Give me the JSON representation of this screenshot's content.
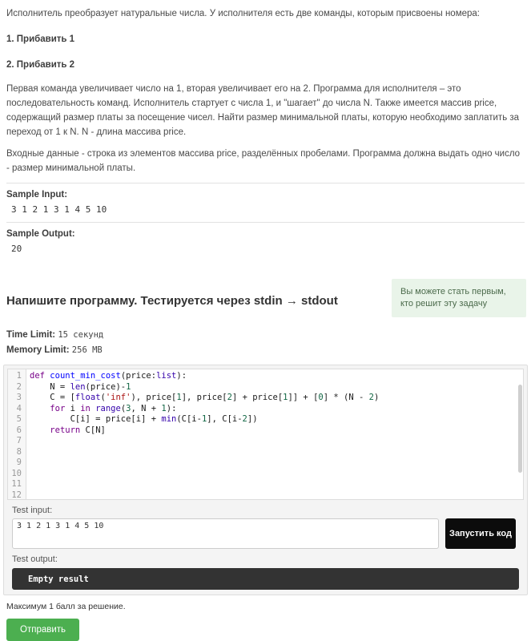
{
  "problem": {
    "intro": "Исполнитель преобразует натуральные числа. У исполнителя есть две команды, которым присвоены номера:",
    "command1": "1. Прибавить 1",
    "command2": "2. Прибавить 2",
    "description": "Первая команда увеличивает число на 1, вторая увеличивает его на 2. Программа для исполнителя – это последовательность команд. Исполнитель стартует с числа 1, и \"шагает\" до числа N. Также имеется массив price, содержащий размер платы за посещение чисел. Найти размер минимальной платы, которую необходимо заплатить за  переход от 1 к N. N - длина массива price.",
    "io_note": "Входные данные - строка из элементов массива price, разделённых  пробелами. Программа должна выдать одно число - размер минимальной платы."
  },
  "samples": {
    "input_label": "Sample Input:",
    "input_value": "3 1 2 1 3 1 4 5 10",
    "output_label": "Sample Output:",
    "output_value": "20"
  },
  "notice": {
    "text": "Вы можете стать первым, кто решит эту задачу",
    "bg_color": "#e9f4e9",
    "text_color": "#4c6b4c"
  },
  "task": {
    "heading": "Напишите программу. Тестируется через stdin → stdout",
    "time_limit_label": "Time Limit:",
    "time_limit_value": "15  секунд",
    "memory_limit_label": "Memory Limit:",
    "memory_limit_value": "256  MB"
  },
  "editor": {
    "line_count": 12,
    "colors": {
      "k": "#770088",
      "b": "#3300aa",
      "d": "#0000ff",
      "n": "#116644",
      "s": "#aa1111",
      "p": "#1a1a1a"
    },
    "lines": [
      [
        [
          "k",
          "def"
        ],
        [
          "p",
          " "
        ],
        [
          "d",
          "count_min_cost"
        ],
        [
          "p",
          "(price:"
        ],
        [
          "b",
          "list"
        ],
        [
          "p",
          "):"
        ]
      ],
      [
        [
          "p",
          "    N = "
        ],
        [
          "b",
          "len"
        ],
        [
          "p",
          "(price)-"
        ],
        [
          "n",
          "1"
        ]
      ],
      [
        [
          "p",
          "    C = ["
        ],
        [
          "b",
          "float"
        ],
        [
          "p",
          "("
        ],
        [
          "s",
          "'inf'"
        ],
        [
          "p",
          "), price["
        ],
        [
          "n",
          "1"
        ],
        [
          "p",
          "], price["
        ],
        [
          "n",
          "2"
        ],
        [
          "p",
          "] + price["
        ],
        [
          "n",
          "1"
        ],
        [
          "p",
          "]] + ["
        ],
        [
          "n",
          "0"
        ],
        [
          "p",
          "] * (N - "
        ],
        [
          "n",
          "2"
        ],
        [
          "p",
          ")"
        ]
      ],
      [
        [
          "p",
          "    "
        ],
        [
          "k",
          "for"
        ],
        [
          "p",
          " i "
        ],
        [
          "k",
          "in"
        ],
        [
          "p",
          " "
        ],
        [
          "b",
          "range"
        ],
        [
          "p",
          "("
        ],
        [
          "n",
          "3"
        ],
        [
          "p",
          ", N + "
        ],
        [
          "n",
          "1"
        ],
        [
          "p",
          "):"
        ]
      ],
      [
        [
          "p",
          "        C[i] = price[i] + "
        ],
        [
          "b",
          "min"
        ],
        [
          "p",
          "(C[i-"
        ],
        [
          "n",
          "1"
        ],
        [
          "p",
          "], C[i-"
        ],
        [
          "n",
          "2"
        ],
        [
          "p",
          "])"
        ]
      ],
      [
        [
          "p",
          "    "
        ],
        [
          "k",
          "return"
        ],
        [
          "p",
          " C[N]"
        ]
      ],
      [],
      [],
      [],
      [],
      [],
      []
    ]
  },
  "test": {
    "input_label": "Test input:",
    "input_value": "3 1 2 1 3 1 4 5 10",
    "run_button_label": "Запустить код",
    "output_label": "Test output:",
    "output_value": "Empty result"
  },
  "footer": {
    "max_score": "Максимум 1 балл за решение.",
    "submit_label": "Отправить",
    "submit_color": "#4caf50"
  }
}
